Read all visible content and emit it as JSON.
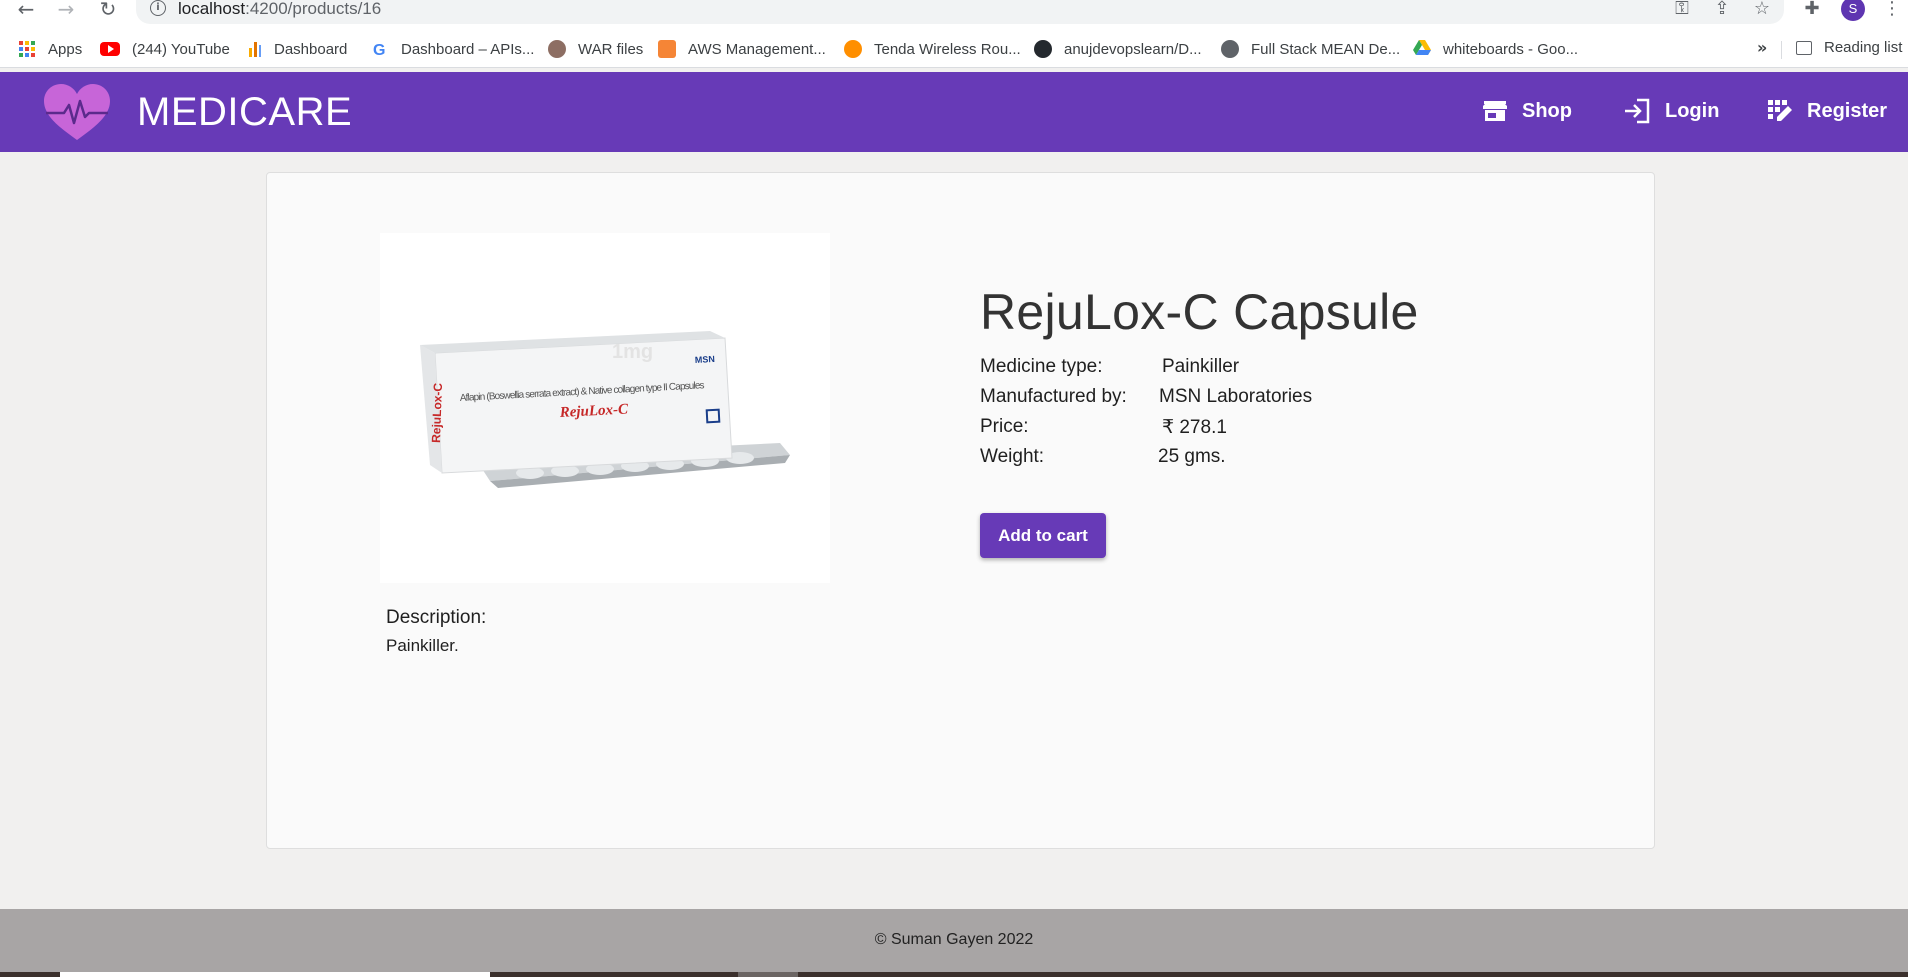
{
  "browser": {
    "url_host": "localhost",
    "url_path": ":4200/products/16",
    "profile_initial": "S",
    "bookmarks": [
      {
        "label": "Apps"
      },
      {
        "label": "(244) YouTube"
      },
      {
        "label": "Dashboard"
      },
      {
        "label": "Dashboard – APIs..."
      },
      {
        "label": "WAR files"
      },
      {
        "label": "AWS Management..."
      },
      {
        "label": "Tenda Wireless Rou..."
      },
      {
        "label": "anujdevopslearn/D..."
      },
      {
        "label": "Full Stack MEAN De..."
      },
      {
        "label": "whiteboards - Goo..."
      }
    ],
    "more_label": "»",
    "reading_list": "Reading list"
  },
  "header": {
    "brand": "MEDICARE",
    "nav": [
      {
        "label": "Shop",
        "icon": "store-icon"
      },
      {
        "label": "Login",
        "icon": "login-icon"
      },
      {
        "label": "Register",
        "icon": "register-icon"
      }
    ],
    "colors": {
      "primary": "#673ab7",
      "logo": "#c765d8"
    }
  },
  "product": {
    "title": "RejuLox-C Capsule",
    "details": [
      {
        "label": "Medicine type:",
        "value": "Painkiller"
      },
      {
        "label": "Manufactured by:",
        "value": "MSN Laboratories"
      },
      {
        "label": "Price:",
        "value": "₹ 278.1"
      },
      {
        "label": "Weight:",
        "value": "25 gms."
      }
    ],
    "add_to_cart": "Add to cart",
    "description_label": "Description:",
    "description": "Painkiller.",
    "image_text": {
      "brand": "RejuLox-C",
      "side": "RejuLox-C",
      "ingredients": "Aflapin (Boswellia serrata extract) & Native collagen type II Capsules",
      "maker": "MSN",
      "watermark": "1mg"
    }
  },
  "footer": {
    "copyright": "© Suman Gayen 2022"
  }
}
